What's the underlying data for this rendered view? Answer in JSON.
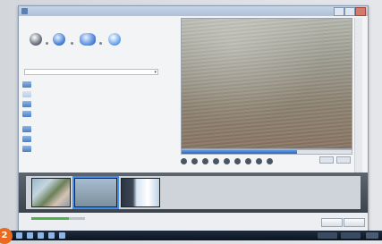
{
  "window": {
    "title": "",
    "header": ""
  },
  "sources": [
    {
      "icon": "camera-icon"
    },
    {
      "icon": "disc-icon"
    },
    {
      "icon": "scanner-icon"
    },
    {
      "icon": "web-icon"
    }
  ],
  "drive_select": {
    "value": "",
    "icon": "chevron-down-icon"
  },
  "tree": [
    {
      "label": "",
      "pale": false
    },
    {
      "label": "",
      "pale": true
    },
    {
      "label": "",
      "pale": false
    },
    {
      "label": "",
      "pale": false
    },
    {
      "label": "",
      "pale": false
    },
    {
      "label": "",
      "pale": false
    },
    {
      "label": "",
      "pale": false
    }
  ],
  "checkbox": {
    "label": ""
  },
  "playback": {
    "progress": 0.68
  },
  "buttons": {
    "ok": "",
    "cancel": ""
  },
  "status": {
    "text": "",
    "right": "",
    "progress": 0.7
  },
  "badge": {
    "number": "2"
  },
  "colors": {
    "accent": "#3d8ef0",
    "badge": "#ea6a1f",
    "progress_green": "#4fb14b"
  }
}
